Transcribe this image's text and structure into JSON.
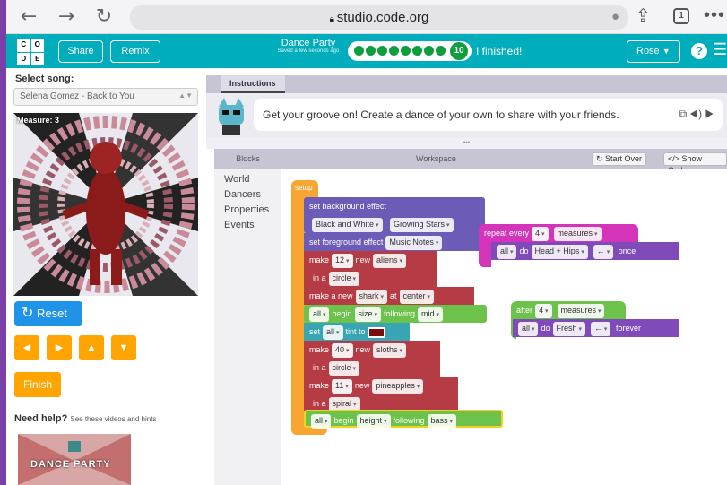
{
  "browser": {
    "url": "studio.code.org",
    "tab_count": "1",
    "back_glyph": "←",
    "forward_glyph": "→",
    "reload_glyph": "↻",
    "share_glyph": "⇪",
    "more_glyph": "•••",
    "mic_glyph": "●"
  },
  "header": {
    "logo_letters": [
      "C",
      "O",
      "D",
      "E"
    ],
    "share_label": "Share",
    "remix_label": "Remix",
    "lesson_title": "Dance Party",
    "save_status": "Saved a few seconds ago",
    "level_number": "10",
    "finished_label": "I finished!",
    "user_name": "Rose",
    "help_glyph": "?",
    "menu_glyph": "☰",
    "colors": {
      "header_bg": "#00adbc",
      "progress_green": "#0e9e3e"
    }
  },
  "left": {
    "song_label": "Select song:",
    "song_value": "Selena Gomez - Back to You",
    "measure_label": "Measure: 3",
    "reset_label": "Reset",
    "arrow_buttons": [
      "◀",
      "▶",
      "▲",
      "▼"
    ],
    "finish_label": "Finish",
    "need_help": "Need help?",
    "need_help_sub": "See these videos and hints",
    "video_label": "DANCE PARTY"
  },
  "instructions": {
    "tab_label": "Instructions",
    "text": "Get your groove on! Create a dance of your own to share with your friends.",
    "controls": "⧉ ◀) ▶"
  },
  "workspace": {
    "toolbox_title": "Blocks",
    "workspace_title": "Workspace",
    "categories": [
      "World",
      "Dancers",
      "Properties",
      "Events"
    ],
    "start_over": "↻ Start Over",
    "show_code": "</> Show Code",
    "blocks": {
      "setup": "setup",
      "set_bg": "set background effect",
      "bg_palette": "Black and White",
      "bg_effect": "Growing Stars",
      "set_fg": "set foreground effect",
      "fg_effect": "Music Notes",
      "make1": "make",
      "make1_count": "12",
      "make1_new": "new",
      "make1_type": "aliens",
      "make1_in": "in a",
      "make1_shape": "circle",
      "make_shark": "make a new",
      "shark": "shark",
      "at": "at",
      "center": "center",
      "all1": "all",
      "begin": "begin",
      "size": "size",
      "following": "following",
      "mid": "mid",
      "set": "set",
      "all2": "all",
      "tint_to": "tint to",
      "make2": "make",
      "make2_count": "40",
      "make2_new": "new",
      "make2_type": "sloths",
      "make2_in": "in a",
      "make2_shape": "circle",
      "make3": "make",
      "make3_count": "11",
      "make3_new": "new",
      "make3_type": "pineapples",
      "make3_in": "in a",
      "make3_shape": "spiral",
      "all3": "all",
      "begin2": "begin",
      "height": "height",
      "following2": "following",
      "bass": "bass",
      "repeat_every": "repeat every",
      "repeat_count": "4",
      "measures": "measures",
      "all4": "all",
      "do": "do",
      "head_hips": "Head + Hips",
      "arrow_left": "←",
      "once": "once",
      "after": "after",
      "after_count": "4",
      "measures2": "measures",
      "all5": "all",
      "do2": "do",
      "fresh": "Fresh",
      "arrow_left2": "←",
      "forever": "forever"
    }
  }
}
